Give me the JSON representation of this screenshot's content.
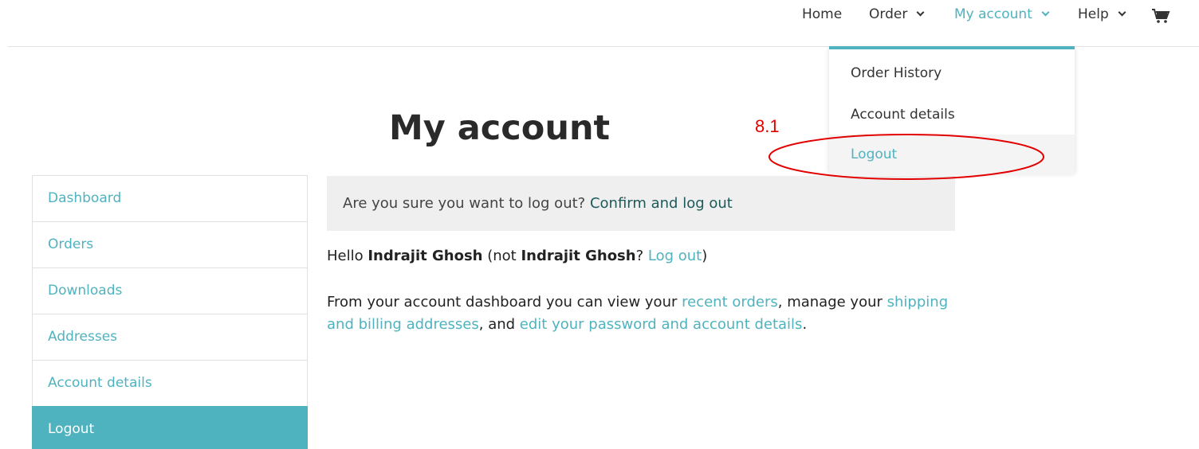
{
  "nav": {
    "home": "Home",
    "order": "Order",
    "my_account": "My account",
    "help": "Help"
  },
  "dropdown": {
    "items": [
      {
        "label": "Order History"
      },
      {
        "label": "Account details"
      },
      {
        "label": "Logout"
      }
    ]
  },
  "annotation": {
    "label": "8.1",
    "color": "#e30000"
  },
  "page": {
    "title": "My account"
  },
  "sidebar": {
    "items": [
      {
        "label": "Dashboard"
      },
      {
        "label": "Orders"
      },
      {
        "label": "Downloads"
      },
      {
        "label": "Addresses"
      },
      {
        "label": "Account details"
      },
      {
        "label": "Logout"
      }
    ]
  },
  "notice": {
    "text": "Are you sure you want to log out?",
    "link": "Confirm and log out"
  },
  "greeting": {
    "hello": "Hello",
    "name": "Indrajit Ghosh",
    "not_prefix": "(not",
    "name2": "Indrajit Ghosh",
    "question": "?",
    "logout_link": "Log out",
    "close": ")"
  },
  "intro": {
    "part1": "From your account dashboard you can view your",
    "link1": "recent orders",
    "part2": ", manage your",
    "link2": "shipping and billing addresses",
    "part3": ", and",
    "link3": "edit your password and account details",
    "part4": "."
  },
  "colors": {
    "accent": "#4fb3bf",
    "notice_bg": "#efefef"
  }
}
